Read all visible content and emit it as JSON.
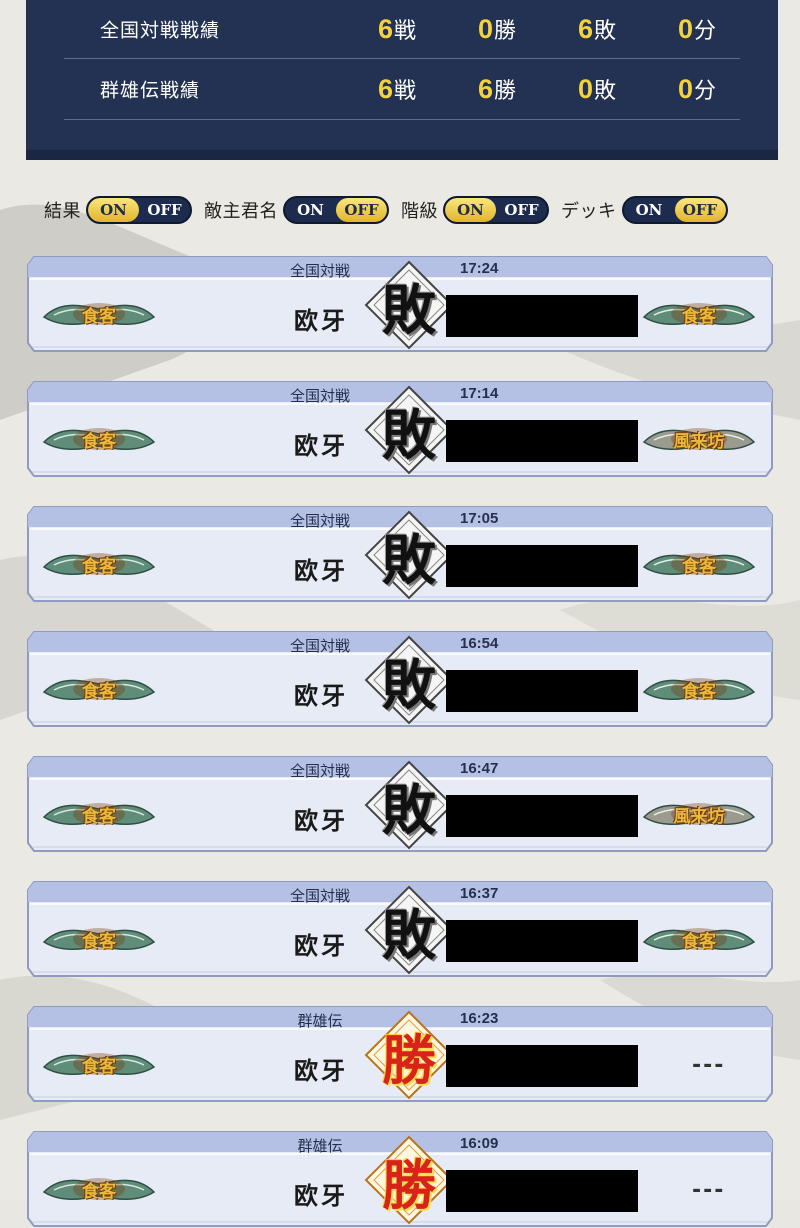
{
  "summary": {
    "rows": [
      {
        "label": "全国対戦戦績",
        "battles": "6",
        "battles_unit": "戦",
        "wins": "0",
        "wins_unit": "勝",
        "losses": "6",
        "losses_unit": "敗",
        "draws": "0",
        "draws_unit": "分"
      },
      {
        "label": "群雄伝戦績",
        "battles": "6",
        "battles_unit": "戦",
        "wins": "6",
        "wins_unit": "勝",
        "losses": "0",
        "losses_unit": "敗",
        "draws": "0",
        "draws_unit": "分"
      }
    ]
  },
  "filters": [
    {
      "label": "結果",
      "on": "ON",
      "off": "OFF",
      "state": "ON"
    },
    {
      "label": "敵主君名",
      "on": "ON",
      "off": "OFF",
      "state": "OFF"
    },
    {
      "label": "階級",
      "on": "ON",
      "off": "OFF",
      "state": "ON"
    },
    {
      "label": "デッキ",
      "on": "ON",
      "off": "OFF",
      "state": "OFF"
    }
  ],
  "battles": [
    {
      "mode": "全国対戦",
      "time": "17:24",
      "player": "欧牙",
      "result": "敗",
      "left_rank": "食客",
      "right_rank": "食客"
    },
    {
      "mode": "全国対戦",
      "time": "17:14",
      "player": "欧牙",
      "result": "敗",
      "left_rank": "食客",
      "right_rank": "風来坊"
    },
    {
      "mode": "全国対戦",
      "time": "17:05",
      "player": "欧牙",
      "result": "敗",
      "left_rank": "食客",
      "right_rank": "食客"
    },
    {
      "mode": "全国対戦",
      "time": "16:54",
      "player": "欧牙",
      "result": "敗",
      "left_rank": "食客",
      "right_rank": "食客"
    },
    {
      "mode": "全国対戦",
      "time": "16:47",
      "player": "欧牙",
      "result": "敗",
      "left_rank": "食客",
      "right_rank": "風来坊"
    },
    {
      "mode": "全国対戦",
      "time": "16:37",
      "player": "欧牙",
      "result": "敗",
      "left_rank": "食客",
      "right_rank": "食客"
    },
    {
      "mode": "群雄伝",
      "time": "16:23",
      "player": "欧牙",
      "result": "勝",
      "left_rank": "食客",
      "right_rank": "---"
    },
    {
      "mode": "群雄伝",
      "time": "16:09",
      "player": "欧牙",
      "result": "勝",
      "left_rank": "食客",
      "right_rank": "---"
    }
  ],
  "colors": {
    "panel": "#233152",
    "accent": "#f4d23c",
    "lose": "#111111",
    "win": "#d8231a",
    "card_header": "#aebbe0",
    "card_body": "#e8ecf6"
  },
  "icons": {
    "result_frame": "diamond-frame-icon",
    "rank_badge": "ornate-leaf-badge-icon"
  }
}
